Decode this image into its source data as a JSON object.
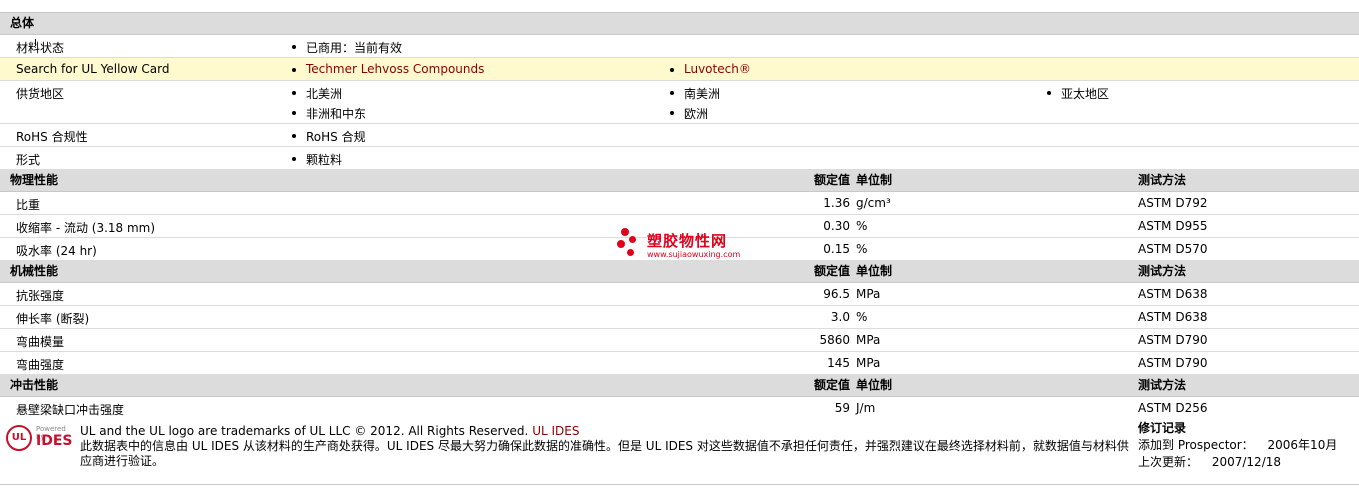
{
  "sections": {
    "general": {
      "title": "总体"
    },
    "physical": {
      "title": "物理性能",
      "rated": "额定值",
      "unit": "单位制",
      "test": "测试方法"
    },
    "mechanical": {
      "title": "机械性能",
      "rated": "额定值",
      "unit": "单位制",
      "test": "测试方法"
    },
    "impact": {
      "title": "冲击性能",
      "rated": "额定值",
      "unit": "单位制",
      "test": "测试方法"
    }
  },
  "general": {
    "material_status": {
      "label": "材料状态",
      "value": "已商用：当前有效"
    },
    "yellow_card": {
      "label": "Search for UL Yellow Card",
      "links": [
        "Techmer Lehvoss Compounds",
        "Luvotech®"
      ]
    },
    "supply": {
      "label": "供货地区",
      "regions": [
        "北美洲",
        "南美洲",
        "亚太地区",
        "非洲和中东",
        "欧洲"
      ]
    },
    "rohs": {
      "label": "RoHS 合规性",
      "value": "RoHS 合规"
    },
    "form": {
      "label": "形式",
      "value": "颗粒料"
    }
  },
  "physical": [
    {
      "name": "比重",
      "value": "1.36",
      "unit": "g/cm³",
      "test": "ASTM D792"
    },
    {
      "name": "收缩率 - 流动 (3.18 mm)",
      "value": "0.30",
      "unit": "%",
      "test": "ASTM D955"
    },
    {
      "name": "吸水率 (24 hr)",
      "value": "0.15",
      "unit": "%",
      "test": "ASTM D570"
    }
  ],
  "mechanical": [
    {
      "name": "抗张强度",
      "value": "96.5",
      "unit": "MPa",
      "test": "ASTM D638"
    },
    {
      "name": "伸长率 (断裂)",
      "value": "3.0",
      "unit": "%",
      "test": "ASTM D638"
    },
    {
      "name": "弯曲模量",
      "value": "5860",
      "unit": "MPa",
      "test": "ASTM D790"
    },
    {
      "name": "弯曲强度",
      "value": "145",
      "unit": "MPa",
      "test": "ASTM D790"
    }
  ],
  "impact": [
    {
      "name": "悬壁梁缺口冲击强度",
      "value": "59",
      "unit": "J/m",
      "test": "ASTM D256"
    }
  ],
  "watermark": {
    "title": "塑胶物性网",
    "url": "www.sujiaowuxing.com"
  },
  "footer": {
    "logo_powered": "Powered by",
    "logo_ul": "UL",
    "logo_ides": "IDES",
    "trademark": "UL and the UL logo are trademarks of UL LLC © 2012. All Rights Reserved.",
    "ul_ides_link": "UL IDES",
    "disclaimer": "此数据表中的信息由 UL IDES 从该材料的生产商处获得。UL IDES 尽最大努力确保此数据的准确性。但是 UL IDES 对这些数据值不承担任何责任，并强烈建议在最终选择材料前，就数据值与材料供应商进行验证。",
    "revision_title": "修订记录",
    "added_label": "添加到 Prospector：",
    "added_value": "2006年10月",
    "updated_label": "上次更新：",
    "updated_value": "2007/12/18"
  },
  "colors": {
    "accent_red": "#8b0000",
    "watermark_red": "#e2001a",
    "highlight_yellow": "#fffacd",
    "section_gray": "#dcdcdc"
  }
}
